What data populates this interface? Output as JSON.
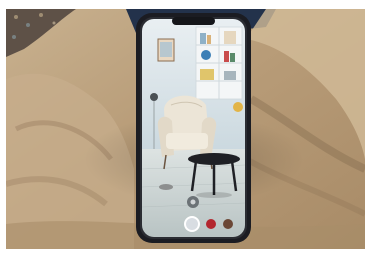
{
  "scene": {
    "subject": "smartphone",
    "colors": {
      "fabric_light": "#d8c4a5",
      "fabric_mid": "#b99f7d",
      "fabric_dark": "#6f5a43",
      "phone_body": "#1b1c22",
      "wall": "#d7e3e8",
      "chair": "#e9e2d5",
      "table": "#1f2025",
      "floor": "#cfd8d8",
      "swatch_selected": "#d8dde2",
      "swatch_red": "#b3262e",
      "swatch_brown": "#6b4736"
    }
  }
}
